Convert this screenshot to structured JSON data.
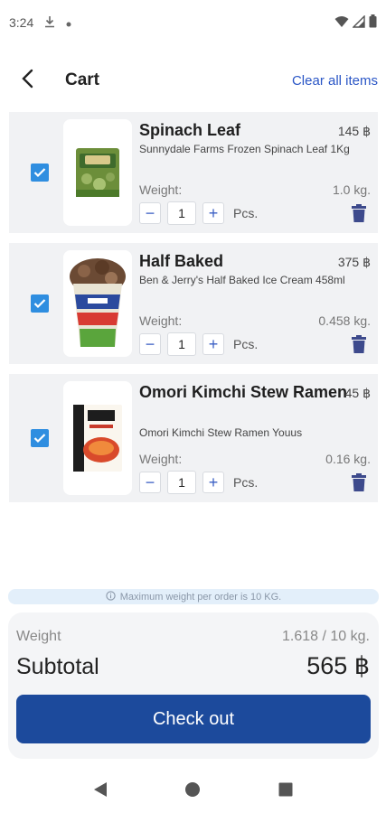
{
  "status_bar": {
    "time": "3:24",
    "icons": [
      "download-icon",
      "dot-icon",
      "wifi-icon",
      "signal-icon",
      "battery-icon"
    ]
  },
  "header": {
    "title": "Cart",
    "clear_label": "Clear all items"
  },
  "items": [
    {
      "name": "Spinach Leaf",
      "price": "145 ฿",
      "description": "Sunnydale Farms Frozen Spinach Leaf 1Kg",
      "weight_label": "Weight:",
      "weight": "1.0 kg.",
      "quantity": "1",
      "unit": "Pcs.",
      "checked": true,
      "thumb": "spinach-pack-image"
    },
    {
      "name": "Half Baked",
      "price": "375 ฿",
      "description": "Ben & Jerry's Half Baked Ice Cream 458ml",
      "weight_label": "Weight:",
      "weight": "0.458 kg.",
      "quantity": "1",
      "unit": "Pcs.",
      "checked": true,
      "thumb": "ice-cream-pint-image"
    },
    {
      "name": "Omori Kimchi Stew Ramen",
      "price": "45 ฿",
      "description": "Omori Kimchi Stew Ramen Youus",
      "weight_label": "Weight:",
      "weight": "0.16 kg.",
      "quantity": "1",
      "unit": "Pcs.",
      "checked": true,
      "thumb": "ramen-pack-image"
    }
  ],
  "notice": {
    "text": "Maximum weight per order is 10 KG.",
    "icon": "info-icon"
  },
  "summary": {
    "weight_label": "Weight",
    "weight_value": "1.618 / 10 kg.",
    "subtotal_label": "Subtotal",
    "subtotal_value": "565 ฿",
    "checkout_label": "Check out"
  },
  "colors": {
    "accent": "#1c4a9c",
    "link": "#2a56c6",
    "checkbox": "#2f8ee0",
    "trash": "#3d4a8c"
  }
}
